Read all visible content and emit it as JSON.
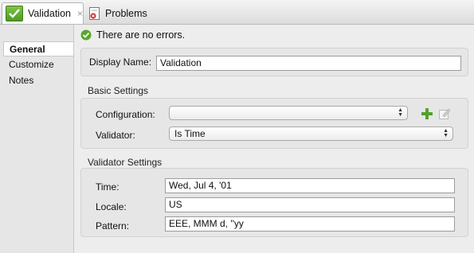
{
  "tabs": [
    {
      "label": "Validation",
      "icon": "check-icon",
      "active": true,
      "close": "×"
    },
    {
      "label": "Problems",
      "icon": "problems-icon",
      "active": false
    }
  ],
  "sidebar": {
    "items": [
      {
        "label": "General",
        "selected": true
      },
      {
        "label": "Customize",
        "selected": false
      },
      {
        "label": "Notes",
        "selected": false
      }
    ]
  },
  "status": {
    "text": "There are no errors.",
    "icon": "ok-icon",
    "color": "#5aa52c"
  },
  "display": {
    "label": "Display Name:",
    "value": "Validation"
  },
  "basic": {
    "title": "Basic Settings",
    "configuration_label": "Configuration:",
    "configuration_value": "",
    "validator_label": "Validator:",
    "validator_value": "Is Time"
  },
  "validator_settings": {
    "title": "Validator Settings",
    "time_label": "Time:",
    "time_value": "Wed, Jul 4, '01",
    "locale_label": "Locale:",
    "locale_value": "US",
    "pattern_label": "Pattern:",
    "pattern_value": "EEE, MMM d, ''yy"
  },
  "colors": {
    "accent_green": "#5aa52c",
    "tab_check_bg": "#5fae2e"
  }
}
